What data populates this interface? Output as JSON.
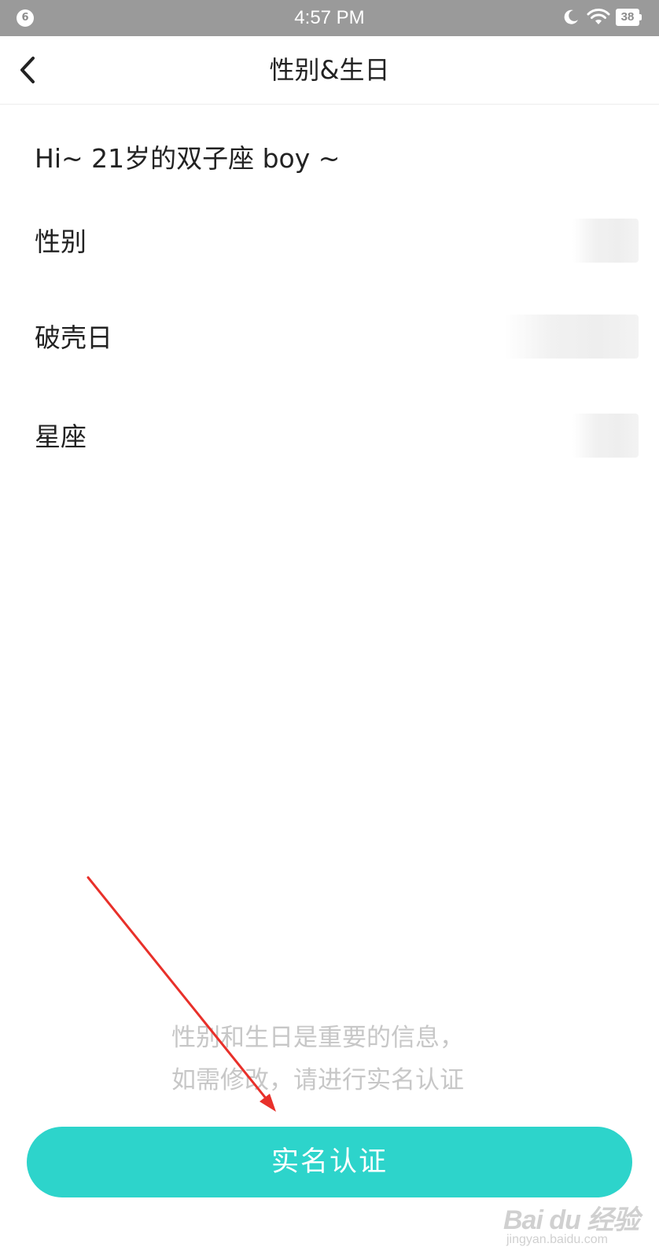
{
  "status_bar": {
    "notification_count": "6",
    "time": "4:57 PM",
    "battery": "38",
    "icons": [
      "moon-icon",
      "wifi-icon",
      "battery-icon"
    ]
  },
  "nav": {
    "title": "性别&生日",
    "back_icon": "chevron-left-icon"
  },
  "greeting": "Hi~ 21岁的双子座 boy ~",
  "rows": [
    {
      "label": "性别"
    },
    {
      "label": "破壳日"
    },
    {
      "label": "星座"
    }
  ],
  "notice": {
    "line1": "性别和生日是重要的信息，",
    "line2": "如需修改，请进行实名认证"
  },
  "primary_button": {
    "label": "实名认证",
    "color": "#2dd4cb"
  },
  "annotation": {
    "arrow_color": "#e8302a"
  },
  "watermark": {
    "brand": "Bai du 经验",
    "url": "jingyan.baidu.com"
  }
}
